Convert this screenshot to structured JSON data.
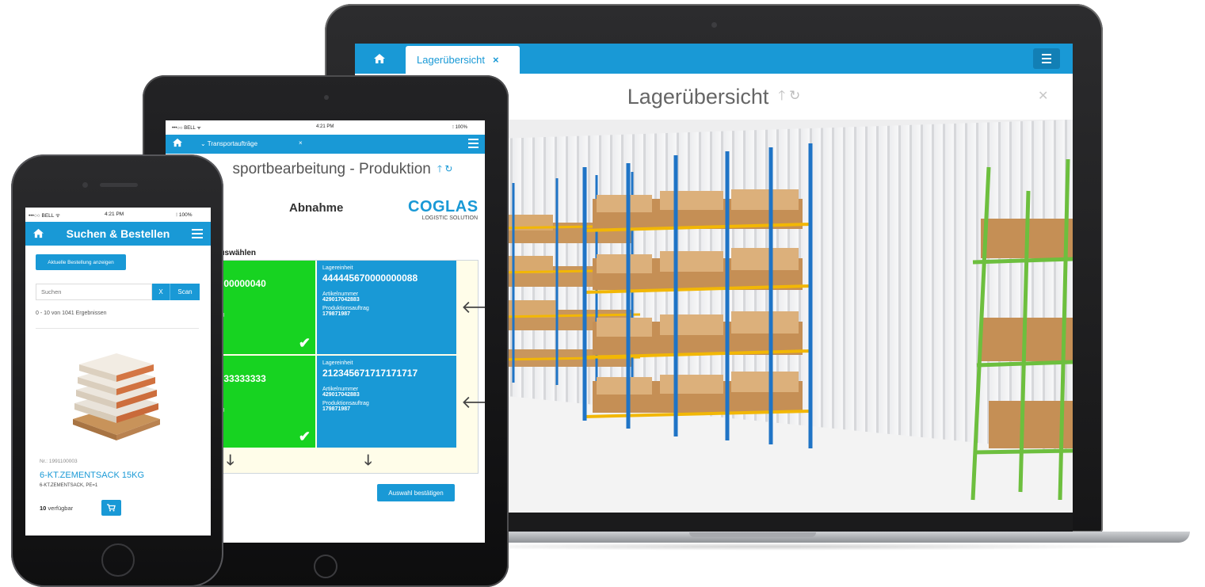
{
  "laptop": {
    "tab_label": "Lagerübersicht",
    "tab_close": "×",
    "home_icon": "home-icon",
    "menu_icon": "hamburger-menu-icon",
    "page_title": "Lagerübersicht",
    "title_icons": "🡑 ↻",
    "close_glyph": "✕"
  },
  "tablet": {
    "status": {
      "carrier": "•••○○ BELL ᯤ",
      "time": "4:21 PM",
      "battery": "⁝ 100%"
    },
    "nav": {
      "tab_label": "⌄  Transportaufträge",
      "tab_close": "×"
    },
    "page_title": "sportbearbeitung - Produktion",
    "title_icons": "🡑 ↻",
    "subtitle": "Abnahme",
    "logo": {
      "brand": "COGLAS",
      "tagline": "LOGISTIC SOLUTION"
    },
    "select_label": "n auswählen",
    "rows": [
      {
        "left_number": "0000000040",
        "left_small_1": "3",
        "left_small_2": "ftrag",
        "right_label": "Lagereinheit",
        "right_number": "444445670000000088",
        "art_label": "Artikelnummer",
        "art_value": "429017042883",
        "prod_label": "Produktionsauftrag",
        "prod_value": "179871987"
      },
      {
        "left_number": "0033333333",
        "left_small_1": "3",
        "left_small_2": "ftrag",
        "right_label": "Lagereinheit",
        "right_number": "212345671717171717",
        "art_label": "Artikelnummer",
        "art_value": "429017042883",
        "prod_label": "Produktionsauftrag",
        "prod_value": "179871987"
      }
    ],
    "confirm_button": "Auswahl bestätigen"
  },
  "phone": {
    "status": {
      "carrier": "•••○○ BELL ᯤ",
      "time": "4:21 PM",
      "battery": "⁝ 100%"
    },
    "title": "Suchen & Bestellen",
    "show_order_button": "Aktuelle Bestellung anzeigen",
    "search_placeholder": "Suchen",
    "clear_button": "X",
    "scan_button": "Scan",
    "results_text": "0 - 10 von 1041 Ergebnissen",
    "product": {
      "number": "Nr.: 1991100003",
      "name": "6-KT.ZEMENTSACK 15KG",
      "description": "6-KT.ZEMENTSACK, PE=1",
      "quantity": "10",
      "availability": "verfügbar"
    }
  },
  "colors": {
    "accent": "#1999d6",
    "success": "#17d321",
    "panel_bg": "#fffde9"
  }
}
